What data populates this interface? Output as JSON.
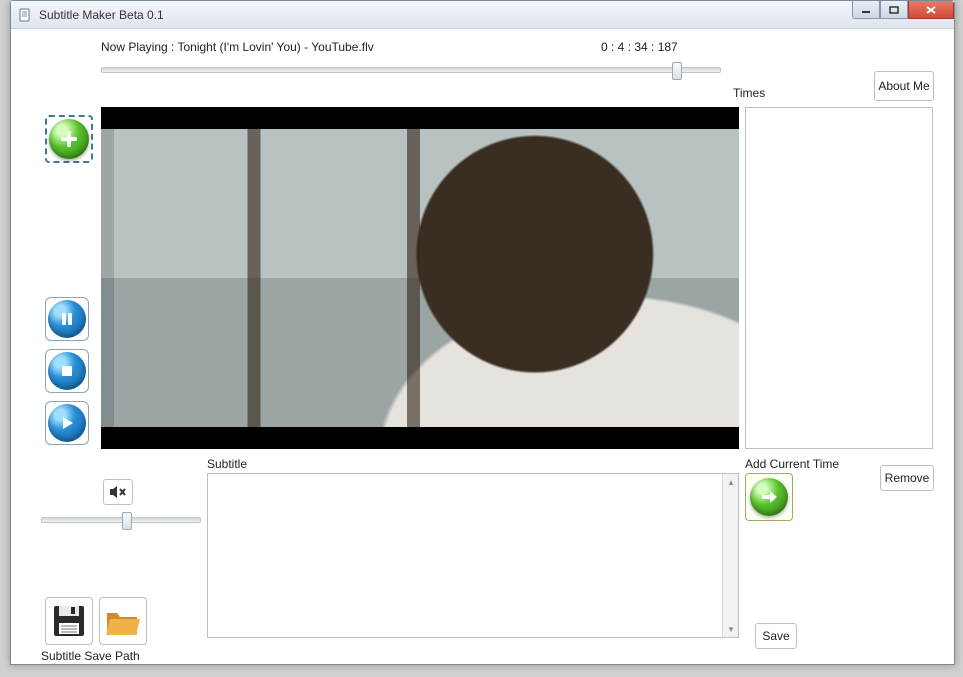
{
  "window": {
    "title": "Subtitle Maker Beta 0.1"
  },
  "player": {
    "now_playing_label": "Now Playing : Tonight (I'm Lovin' You) - YouTube.flv",
    "timecode": "0 : 4 : 34 : 187"
  },
  "labels": {
    "times": "Times",
    "about": "About Me",
    "subtitle": "Subtitle",
    "add_current_time": "Add Current Time",
    "remove": "Remove",
    "save": "Save",
    "save_path": "Subtitle Save Path"
  },
  "icons": {
    "add": "plus-icon",
    "pause": "pause-icon",
    "stop": "stop-icon",
    "play": "play-icon",
    "mute": "mute-icon",
    "arrow": "arrow-right-icon",
    "floppy": "save-icon",
    "folder": "folder-open-icon"
  }
}
